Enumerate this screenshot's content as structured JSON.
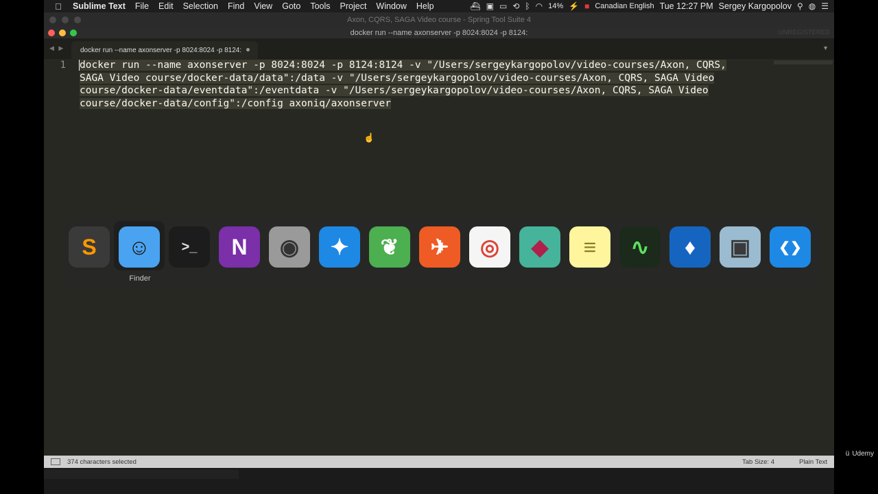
{
  "menubar": {
    "apple": "",
    "app_name": "Sublime Text",
    "menus": [
      "File",
      "Edit",
      "Selection",
      "Find",
      "View",
      "Goto",
      "Tools",
      "Project",
      "Window",
      "Help"
    ],
    "battery": "14%",
    "input_source": "Canadian English",
    "clock": "Tue 12:27 PM",
    "user": "Sergey Kargopolov"
  },
  "background_window": {
    "title": "Axon, CQRS, SAGA Video course - Spring Tool Suite 4"
  },
  "window": {
    "title": "docker run --name axonserver -p 8024:8024 -p 8124:",
    "unregistered": "UNREGISTERED"
  },
  "tab": {
    "label": "docker run --name axonserver -p 8024:8024 -p 8124:"
  },
  "editor": {
    "line_numbers": [
      "1"
    ],
    "wrapped_lines": [
      "docker run --name axonserver -p 8024:8024 -p 8124:8124 -v \"/Users/sergeykargopolov/video-courses/Axon, CQRS,",
      "SAGA Video course/docker-data/data\":/data -v \"/Users/sergeykargopolov/video-courses/Axon, CQRS, SAGA Video",
      "course/docker-data/eventdata\":/eventdata -v \"/Users/sergeykargopolov/video-courses/Axon, CQRS, SAGA Video",
      "course/docker-data/config\":/config axoniq/axonserver"
    ]
  },
  "app_switcher": {
    "selected_label": "Finder",
    "apps": [
      {
        "name": "sublime-text",
        "glyph": "S",
        "bg": "#3a3a3a",
        "fg": "#ff9800"
      },
      {
        "name": "finder",
        "glyph": "☺",
        "bg": "#4aa3f0",
        "fg": "#1a1a1a"
      },
      {
        "name": "terminal",
        "glyph": ">_",
        "bg": "#1c1c1c",
        "fg": "#e0e0e0"
      },
      {
        "name": "onenote",
        "glyph": "N",
        "bg": "#7b2fa8",
        "fg": "#ffffff"
      },
      {
        "name": "final-cut",
        "glyph": "◉",
        "bg": "#9a9a9a",
        "fg": "#333333"
      },
      {
        "name": "safari",
        "glyph": "✦",
        "bg": "#1e88e5",
        "fg": "#ffffff"
      },
      {
        "name": "spring-tool-suite",
        "glyph": "❦",
        "bg": "#4caf50",
        "fg": "#ffffff"
      },
      {
        "name": "postman",
        "glyph": "✈",
        "bg": "#ef5b25",
        "fg": "#ffffff"
      },
      {
        "name": "chrome",
        "glyph": "◎",
        "bg": "#f5f5f5",
        "fg": "#db4437"
      },
      {
        "name": "virtualbox-like",
        "glyph": "◆",
        "bg": "#46b39b",
        "fg": "#b0204a"
      },
      {
        "name": "notes",
        "glyph": "≡",
        "bg": "#fff59d",
        "fg": "#8a7b2a"
      },
      {
        "name": "activity-monitor",
        "glyph": "∿",
        "bg": "#1b2a1b",
        "fg": "#5ee05e"
      },
      {
        "name": "sourcetree",
        "glyph": "♦",
        "bg": "#1565c0",
        "fg": "#ffffff"
      },
      {
        "name": "preview",
        "glyph": "▣",
        "bg": "#9bbbd0",
        "fg": "#3a3a3a"
      },
      {
        "name": "vscode",
        "glyph": "❮❯",
        "bg": "#1e88e5",
        "fg": "#ffffff"
      }
    ]
  },
  "statusbar": {
    "selection_info": "374 characters selected",
    "tab_size": "Tab Size: 4",
    "syntax": "Plain Text"
  },
  "watermark": {
    "label": "Udemy"
  },
  "colors": {
    "editor_bg": "#272822",
    "selection": "#3e3d32",
    "statusbar_bg": "#cfcfcf"
  }
}
